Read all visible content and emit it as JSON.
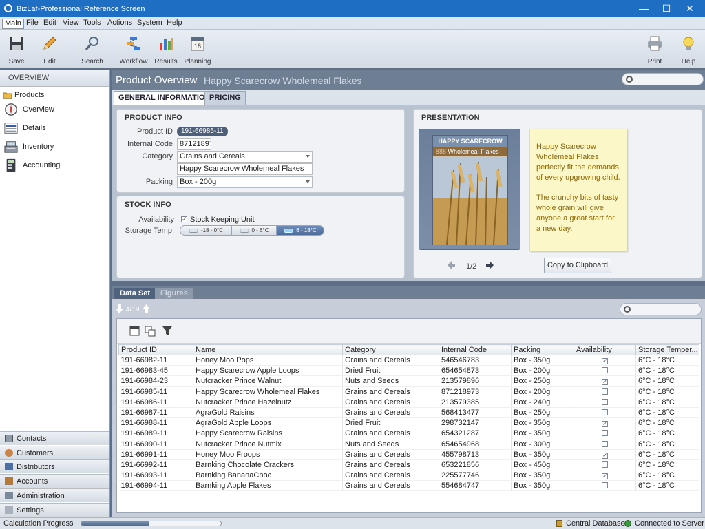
{
  "window": {
    "title": "BizLaf-Professional Reference Screen",
    "minimize": "—",
    "maximize": "☐",
    "close": "✕"
  },
  "menu": [
    "Main",
    "File",
    "Edit",
    "View",
    "Tools",
    "Actions",
    "System",
    "Help"
  ],
  "toolbar": {
    "save": "Save",
    "edit": "Edit",
    "search": "Search",
    "workflow": "Workflow",
    "results": "Results",
    "planning": "Planning",
    "print": "Print",
    "help": "Help"
  },
  "sidebar": {
    "header": "OVERVIEW",
    "root": "Products",
    "items": [
      {
        "label": "Overview",
        "icon": "compass-icon"
      },
      {
        "label": "Details",
        "icon": "details-icon"
      },
      {
        "label": "Inventory",
        "icon": "cash-register-icon"
      },
      {
        "label": "Accounting",
        "icon": "calculator-icon"
      }
    ],
    "nav": [
      {
        "label": "Contacts",
        "icon": "contacts-icon"
      },
      {
        "label": "Customers",
        "icon": "customers-icon"
      },
      {
        "label": "Distributors",
        "icon": "distributors-icon"
      },
      {
        "label": "Accounts",
        "icon": "accounts-icon"
      },
      {
        "label": "Administration",
        "icon": "wrench-icon"
      },
      {
        "label": "Settings",
        "icon": "settings-icon"
      }
    ]
  },
  "main": {
    "title": "Product Overview",
    "subtitle": "Happy Scarecrow Wholemeal Flakes",
    "tabs": [
      "GENERAL INFORMATION",
      "PRICING"
    ],
    "product_info": {
      "title": "PRODUCT INFO",
      "product_id_label": "Product ID",
      "product_id": "191-66985-11",
      "internal_code_label": "Internal Code",
      "internal_code": "871218973",
      "category_label": "Category",
      "category": "Grains and Cereals",
      "name": "Happy Scarecrow Wholemeal Flakes",
      "packing_label": "Packing",
      "packing": "Box - 200g"
    },
    "stock_info": {
      "title": "STOCK INFO",
      "availability_label": "Availability",
      "availability_value": "Stock Keeping Unit",
      "availability_checked": true,
      "storage_label": "Storage Temp.",
      "storage_options": [
        "-18 - 0°C",
        "0 - 6°C",
        "6 - 18°C"
      ],
      "storage_selected": 2
    },
    "presentation": {
      "title": "PRESENTATION",
      "box_brand": "HAPPY SCARECROW",
      "box_product": "Wholemeal Flakes",
      "box_prefix": "888",
      "description_1": "Happy Scarecrow Wholemeal Flakes perfectly fit the demands of every upgrowing child.",
      "description_2": "The crunchy bits of tasty whole grain will give anyone a great start for a new day.",
      "pager": "1/2",
      "copy_button": "Copy to Clipboard"
    }
  },
  "dataset": {
    "tabs": [
      "Data Set",
      "Figures"
    ],
    "nav_counter": "4/19",
    "columns": [
      "Product ID",
      "Name",
      "Category",
      "Internal Code",
      "Packing",
      "Availability",
      "Storage Temper..."
    ],
    "rows": [
      [
        "191-66982-11",
        "Honey Moo Pops",
        "Grains and Cereals",
        "546546783",
        "Box - 350g",
        true,
        "6°C - 18°C"
      ],
      [
        "191-66983-45",
        "Happy Scarecrow Apple Loops",
        "Dried Fruit",
        "654654873",
        "Box - 200g",
        false,
        "6°C - 18°C"
      ],
      [
        "191-66984-23",
        "Nutcracker Prince Walnut",
        "Nuts and Seeds",
        "213579896",
        "Box - 250g",
        true,
        "6°C - 18°C"
      ],
      [
        "191-66985-11",
        "Happy Scarecrow Wholemeal Flakes",
        "Grains and Cereals",
        "871218973",
        "Box - 200g",
        false,
        "6°C - 18°C"
      ],
      [
        "191-66986-11",
        "Nutcracker Prince Hazelnutz",
        "Grains and Cereals",
        "213579385",
        "Box - 240g",
        false,
        "6°C - 18°C"
      ],
      [
        "191-66987-11",
        "AgraGold Raisins",
        "Grains and Cereals",
        "568413477",
        "Box - 250g",
        false,
        "6°C - 18°C"
      ],
      [
        "191-66988-11",
        "AgraGold Apple Loops",
        "Dried Fruit",
        "298732147",
        "Box - 350g",
        true,
        "6°C - 18°C"
      ],
      [
        "191-66989-11",
        "Happy Scarecrow Raisins",
        "Grains and Cereals",
        "654321287",
        "Box - 350g",
        false,
        "6°C - 18°C"
      ],
      [
        "191-66990-11",
        "Nutcracker Prince Nutmix",
        "Nuts and Seeds",
        "654654968",
        "Box - 300g",
        false,
        "6°C - 18°C"
      ],
      [
        "191-66991-11",
        "Honey Moo Froops",
        "Grains and Cereals",
        "455798713",
        "Box - 350g",
        true,
        "6°C - 18°C"
      ],
      [
        "191-66992-11",
        "Barnking Chocolate Crackers",
        "Grains and Cereals",
        "653221856",
        "Box - 450g",
        false,
        "6°C - 18°C"
      ],
      [
        "191-66993-11",
        "Barnking BananaChoc",
        "Grains and Cereals",
        "225577746",
        "Box - 350g",
        true,
        "6°C - 18°C"
      ],
      [
        "191-66994-11",
        "Barnking Apple Flakes",
        "Grains and Cereals",
        "554684747",
        "Box - 350g",
        false,
        "6°C - 18°C"
      ]
    ]
  },
  "status": {
    "progress_label": "Calculation Progress",
    "progress": 0.49,
    "database": "Central Database",
    "connection": "Connected to Server"
  },
  "colors": {
    "title_bar": "#1e6fc4",
    "header": "#6f7f93",
    "accent": "#4e5f77",
    "note": "#fbf7c9"
  }
}
